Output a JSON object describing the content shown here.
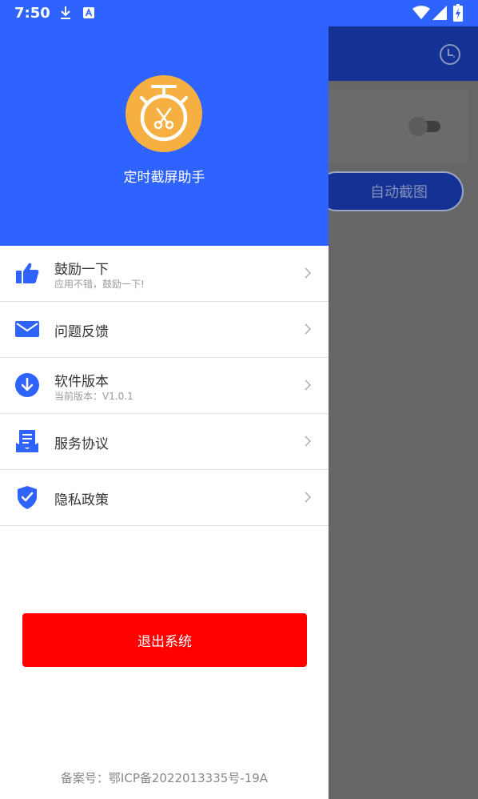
{
  "status_bar": {
    "time": "7:50",
    "icons": [
      "download-icon",
      "a-notification-icon",
      "wifi-icon",
      "signal-icon",
      "battery-charging-icon"
    ]
  },
  "drawer": {
    "app_name": "定时截屏助手",
    "logo_icon": "stopwatch-scissors-icon",
    "menu": [
      {
        "icon": "thumbs-up-icon",
        "title": "鼓励一下",
        "subtitle": "应用不错，鼓励一下!"
      },
      {
        "icon": "mail-icon",
        "title": "问题反馈",
        "subtitle": ""
      },
      {
        "icon": "download-circle-icon",
        "title": "软件版本",
        "subtitle": "当前版本：V1.0.1"
      },
      {
        "icon": "agreement-icon",
        "title": "服务协议",
        "subtitle": ""
      },
      {
        "icon": "shield-check-icon",
        "title": "隐私政策",
        "subtitle": ""
      }
    ],
    "logout_label": "退出系统",
    "icp_text": "备案号：鄂ICP备2022013335号-19A"
  },
  "background_app": {
    "auto_capture_label": "自动截图",
    "history_icon": "clock-icon"
  },
  "colors": {
    "primary": "#2f63ff",
    "logo": "#f6b042",
    "logout": "#ff0000",
    "scrim": "#666666",
    "dim_primary": "#143194"
  }
}
